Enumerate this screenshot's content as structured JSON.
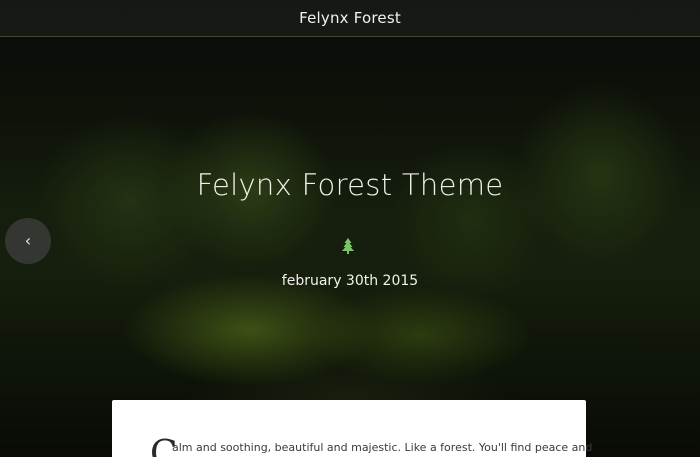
{
  "header": {
    "site_title": "Felynx Forest"
  },
  "hero": {
    "title": "Felynx Forest Theme",
    "date": "february 30th 2015",
    "icon": "tree-icon",
    "prev_icon": "chevron-left-icon",
    "prev_glyph": "‹"
  },
  "article": {
    "drop_cap": "C",
    "intro_line": "alm and soothing, beautiful and majestic. Like a forest. You'll find peace and"
  },
  "colors": {
    "accent": "#7bc46a",
    "top_bar": "#181a16",
    "card": "#ffffff"
  }
}
